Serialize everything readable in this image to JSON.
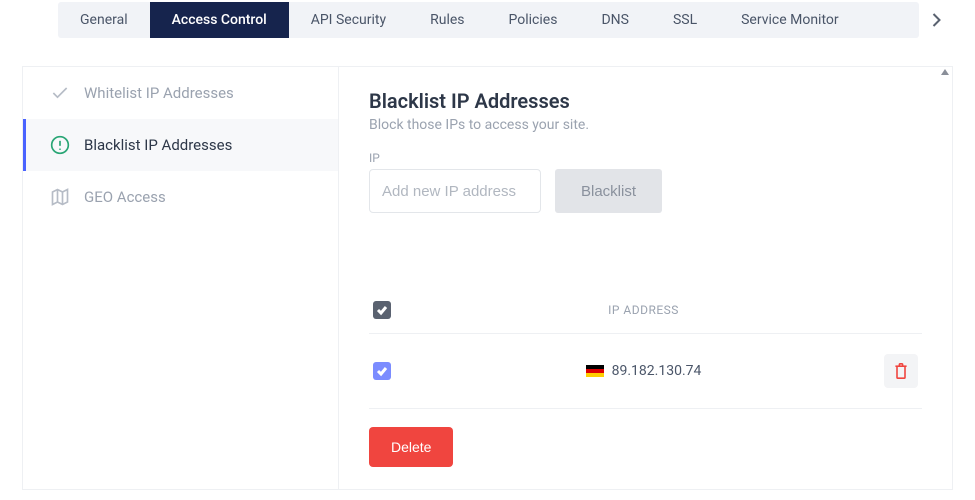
{
  "tabs": {
    "items": [
      "General",
      "Access Control",
      "API Security",
      "Rules",
      "Policies",
      "DNS",
      "SSL",
      "Service Monitor"
    ],
    "active_index": 1
  },
  "sidebar": {
    "items": [
      {
        "label": "Whitelist IP Addresses"
      },
      {
        "label": "Blacklist IP Addresses"
      },
      {
        "label": "GEO Access"
      }
    ],
    "active_index": 1
  },
  "main": {
    "title": "Blacklist IP Addresses",
    "subtitle": "Block those IPs to access your site.",
    "ip_field_label": "IP",
    "ip_placeholder": "Add new IP address",
    "blacklist_button": "Blacklist",
    "table_header": "IP ADDRESS",
    "rows": [
      {
        "ip": "89.182.130.74",
        "country": "DE",
        "checked": true
      }
    ],
    "delete_button": "Delete"
  }
}
